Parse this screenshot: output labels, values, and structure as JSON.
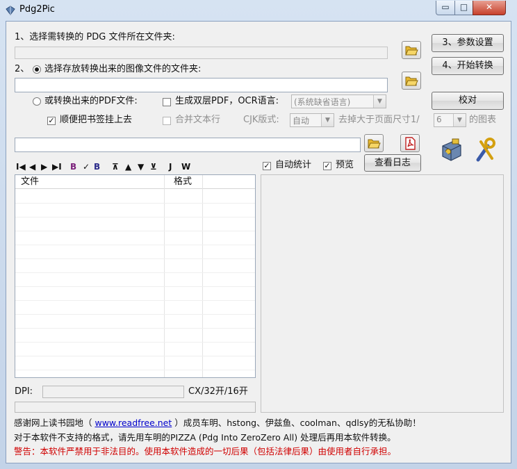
{
  "window": {
    "title": "Pdg2Pic",
    "min_glyph": "▭",
    "max_glyph": "□",
    "close_glyph": "✕"
  },
  "step1": {
    "label": "1、选择需转换的 PDG 文件所在文件夹:",
    "value": ""
  },
  "step2": {
    "prefix": "2、",
    "label": "选择存放转换出来的图像文件的文件夹:",
    "value": ""
  },
  "pdf_option": {
    "label": "或转换出来的PDF文件:"
  },
  "dual_layer": {
    "label": "生成双层PDF，OCR语言:",
    "checked": false
  },
  "ocr_lang": {
    "value": "(系统缺省语言)"
  },
  "bookmarks": {
    "label": "顺便把书签挂上去",
    "checked": true
  },
  "merge_lines": {
    "label": "合并文本行",
    "checked": false
  },
  "cjk": {
    "label": "CJK版式:",
    "value": "自动"
  },
  "remove_large": {
    "label": "去掉大于页面尺寸1/",
    "value": "6",
    "suffix": "的图表"
  },
  "pdf_path": {
    "value": ""
  },
  "buttons": {
    "settings": "3、参数设置",
    "start": "4、开始转换",
    "proofread": "校对",
    "view_log": "查看日志"
  },
  "toolbar": {
    "first": "I◀",
    "prev": "◀",
    "next": "▶",
    "last": "▶I",
    "tool1": "B",
    "tool2": "✓",
    "tool3": "B",
    "top": "⊼",
    "up": "▲",
    "down": "▼",
    "bottom": "⊻",
    "j": "J",
    "w": "W"
  },
  "auto_stats": {
    "label": "自动统计",
    "checked": true
  },
  "preview_opt": {
    "label": "预览",
    "checked": true
  },
  "file_list": {
    "columns": [
      "文件",
      "格式"
    ],
    "rows": []
  },
  "dpi": {
    "label": "DPI:",
    "value": "",
    "format": "CX/32开/16开"
  },
  "progress": 0,
  "footer": {
    "thanks_prefix": "感谢网上读书园地（ ",
    "link": "www.readfree.net",
    "thanks_suffix": " ）成员车明、hstong、伊兹鱼、coolman、qdlsy的无私协助！",
    "line2": "对于本软件不支持的格式，请先用车明的PIZZA (Pdg Into ZeroZero All) 处理后再用本软件转换。",
    "warning": "警告：本软件严禁用于非法目的。使用本软件造成的一切后果（包括法律后果）由使用者自行承担。"
  },
  "colors": {
    "link": "#0000cc",
    "warning": "#d00000",
    "folder": "#e8b830"
  },
  "icons": [
    "app-icon",
    "folder-open-icon",
    "pdf-icon",
    "package-icon",
    "wrench-icon"
  ]
}
